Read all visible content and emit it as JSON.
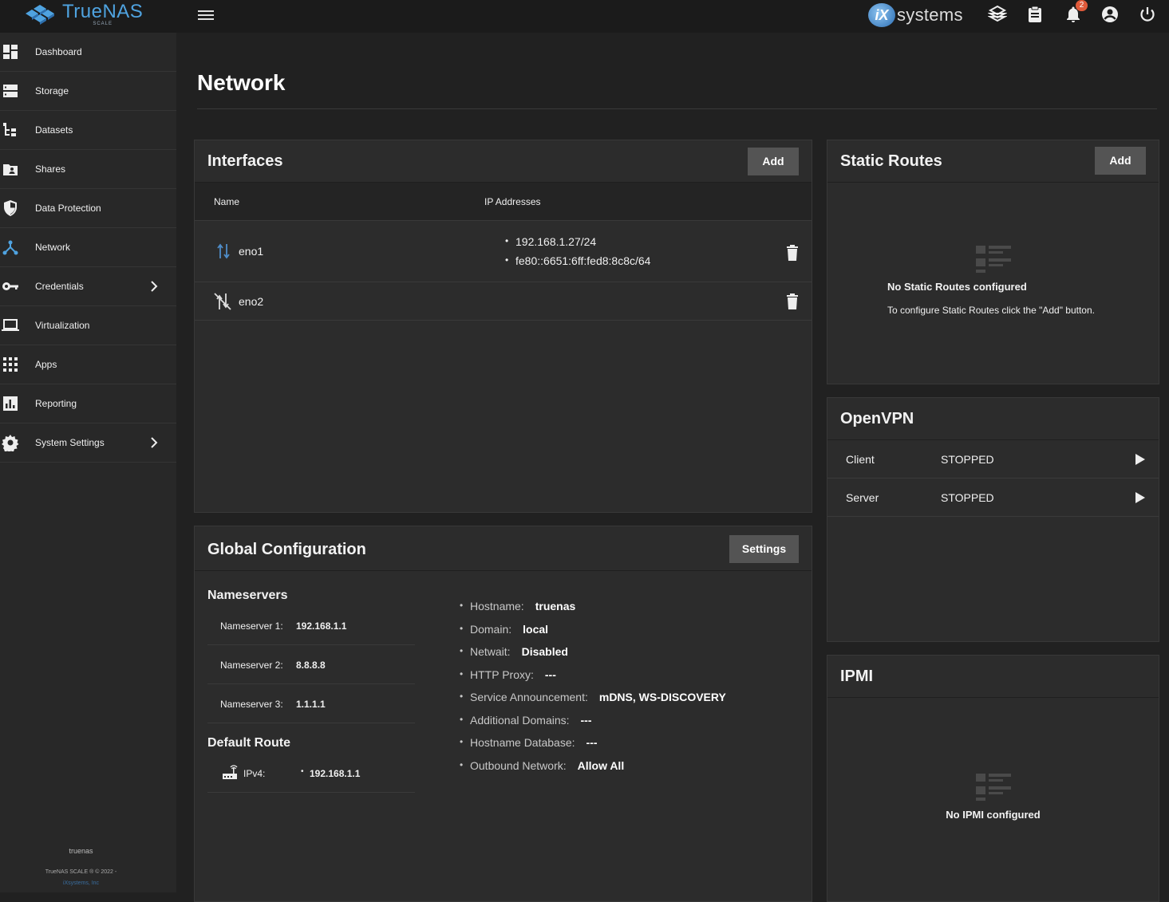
{
  "topbar": {
    "brand": "TrueNAS",
    "brand_sub": "SCALE",
    "ix_mark": "iX",
    "ix_text": "systems",
    "notification_count": "2",
    "icons": [
      "truecommand-icon",
      "clipboard-icon",
      "bell-icon",
      "account-icon",
      "power-icon"
    ]
  },
  "sidebar": {
    "items": [
      {
        "label": "Dashboard",
        "icon": "dashboard-icon"
      },
      {
        "label": "Storage",
        "icon": "storage-icon"
      },
      {
        "label": "Datasets",
        "icon": "datasets-icon"
      },
      {
        "label": "Shares",
        "icon": "shares-icon"
      },
      {
        "label": "Data Protection",
        "icon": "shield-icon"
      },
      {
        "label": "Network",
        "icon": "network-icon"
      },
      {
        "label": "Credentials",
        "icon": "key-icon"
      },
      {
        "label": "Virtualization",
        "icon": "laptop-icon"
      },
      {
        "label": "Apps",
        "icon": "apps-icon"
      },
      {
        "label": "Reporting",
        "icon": "chart-icon"
      },
      {
        "label": "System Settings",
        "icon": "gear-icon"
      }
    ],
    "hostname": "truenas",
    "copyright": "TrueNAS SCALE ® © 2022 -",
    "company": "iXsystems, Inc"
  },
  "page": {
    "title": "Network"
  },
  "interfaces": {
    "title": "Interfaces",
    "add_label": "Add",
    "col_name": "Name",
    "col_ip": "IP Addresses",
    "rows": [
      {
        "name": "eno1",
        "ips": [
          "192.168.1.27/24",
          "fe80::6651:6ff:fed8:8c8c/64"
        ]
      },
      {
        "name": "eno2",
        "ips": []
      }
    ]
  },
  "static_routes": {
    "title": "Static Routes",
    "add_label": "Add",
    "empty_title": "No Static Routes configured",
    "empty_sub": "To configure Static Routes click the \"Add\" button."
  },
  "openvpn": {
    "title": "OpenVPN",
    "rows": [
      {
        "label": "Client",
        "status": "STOPPED"
      },
      {
        "label": "Server",
        "status": "STOPPED"
      }
    ]
  },
  "ipmi": {
    "title": "IPMI",
    "empty_title": "No IPMI configured"
  },
  "global_config": {
    "title": "Global Configuration",
    "settings_label": "Settings",
    "nameservers_heading": "Nameservers",
    "nameservers": [
      {
        "label": "Nameserver 1:",
        "value": "192.168.1.1"
      },
      {
        "label": "Nameserver 2:",
        "value": "8.8.8.8"
      },
      {
        "label": "Nameserver 3:",
        "value": "1.1.1.1"
      }
    ],
    "default_route_heading": "Default Route",
    "ipv4_label": "IPv4:",
    "ipv4_value": "192.168.1.1",
    "items": [
      {
        "label": "Hostname:",
        "value": "truenas"
      },
      {
        "label": "Domain:",
        "value": "local"
      },
      {
        "label": "Netwait:",
        "value": "Disabled"
      },
      {
        "label": "HTTP Proxy:",
        "value": "---"
      },
      {
        "label": "Service Announcement:",
        "value": "mDNS, WS-DISCOVERY"
      },
      {
        "label": "Additional Domains:",
        "value": "---"
      },
      {
        "label": "Hostname Database:",
        "value": "---"
      },
      {
        "label": "Outbound Network:",
        "value": "Allow All"
      }
    ]
  }
}
